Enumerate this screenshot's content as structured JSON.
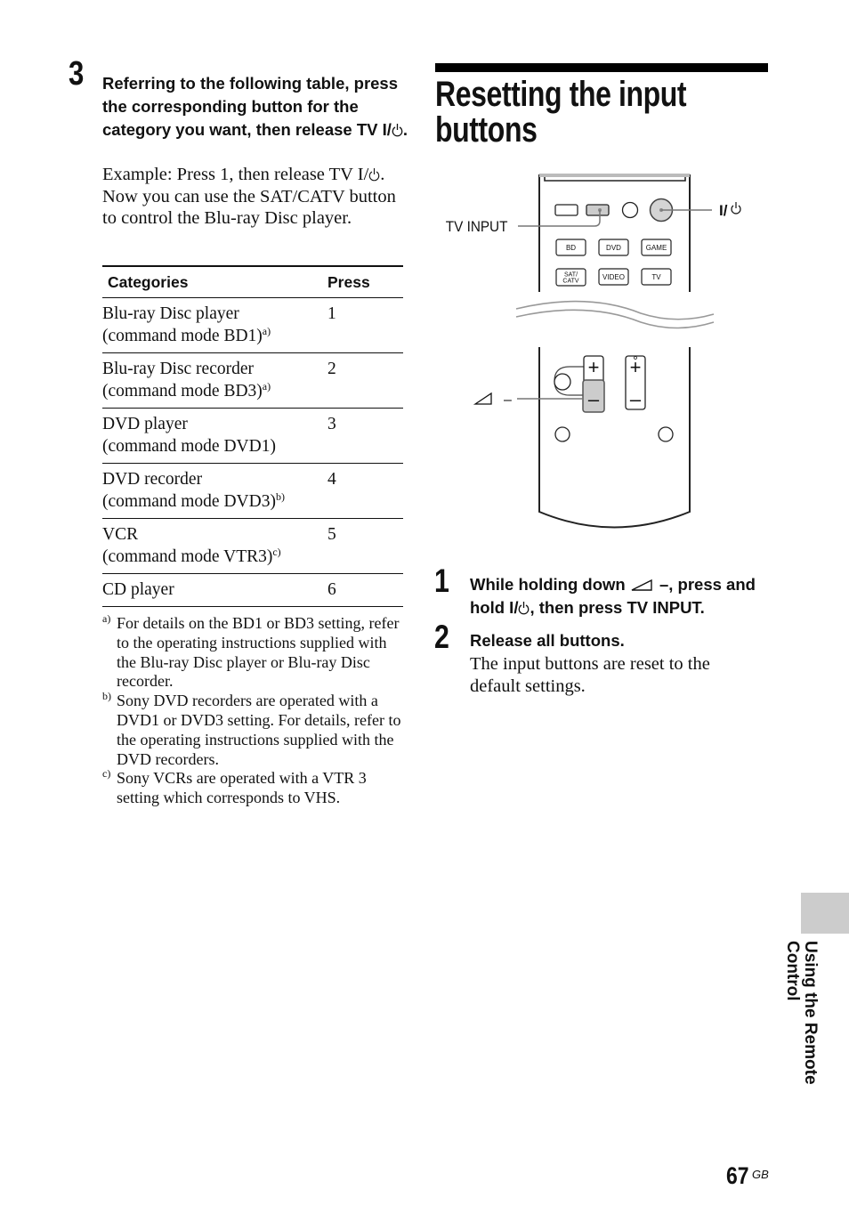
{
  "left_column": {
    "step3": {
      "number": "3",
      "heading_parts": [
        "Referring to the following table, press the corresponding button for the category you want, then release TV I/",
        "."
      ],
      "body_parts": [
        "Example: Press 1, then release TV I/",
        ". Now you can use the SAT/CATV button to control the Blu-ray Disc player."
      ]
    },
    "table": {
      "headers": [
        "Categories",
        "Press"
      ],
      "rows": [
        {
          "line1": "Blu-ray Disc player",
          "line2": "(command mode BD1)",
          "note": "a)",
          "press": "1"
        },
        {
          "line1": "Blu-ray Disc recorder",
          "line2": "(command mode BD3)",
          "note": "a)",
          "press": "2"
        },
        {
          "line1": "DVD player",
          "line2": "(command mode DVD1)",
          "note": "",
          "press": "3"
        },
        {
          "line1": "DVD recorder",
          "line2": "(command mode DVD3)",
          "note": "b)",
          "press": "4"
        },
        {
          "line1": "VCR",
          "line2": "(command mode VTR3)",
          "note": "c)",
          "press": "5"
        },
        {
          "line1": "CD player",
          "line2": "",
          "note": "",
          "press": "6"
        }
      ]
    },
    "footnotes": [
      {
        "mark": "a)",
        "text": "For details on the BD1 or BD3 setting, refer to the operating instructions supplied with the Blu-ray Disc player or Blu-ray Disc recorder."
      },
      {
        "mark": "b)",
        "text": "Sony DVD recorders are operated with a DVD1 or DVD3 setting. For details, refer to the operating instructions supplied with the DVD recorders."
      },
      {
        "mark": "c)",
        "text": "Sony VCRs are operated with a VTR 3 setting which corresponds to VHS."
      }
    ]
  },
  "right_column": {
    "title": "Resetting the input buttons",
    "illustration": {
      "callout_tv_input": "TV INPUT",
      "callout_power": "I/",
      "callout_volume": "–",
      "buttons_row1": [
        "BD",
        "DVD",
        "GAME"
      ],
      "buttons_row2": [
        "SAT/",
        "CATV",
        "VIDEO",
        "TV"
      ],
      "rocker_plus": "+",
      "rocker_minus": "–"
    },
    "steps": [
      {
        "number": "1",
        "heading_parts": [
          "While holding down ",
          " –, press and hold I/",
          ", then press TV INPUT."
        ],
        "body": ""
      },
      {
        "number": "2",
        "heading_parts": [
          "Release all buttons."
        ],
        "body": "The input buttons are reset to the default settings."
      }
    ]
  },
  "side_tab": {
    "label": "Using the Remote Control",
    "color": "#cccccc"
  },
  "footer": {
    "page_number": "67",
    "suffix": "GB"
  }
}
